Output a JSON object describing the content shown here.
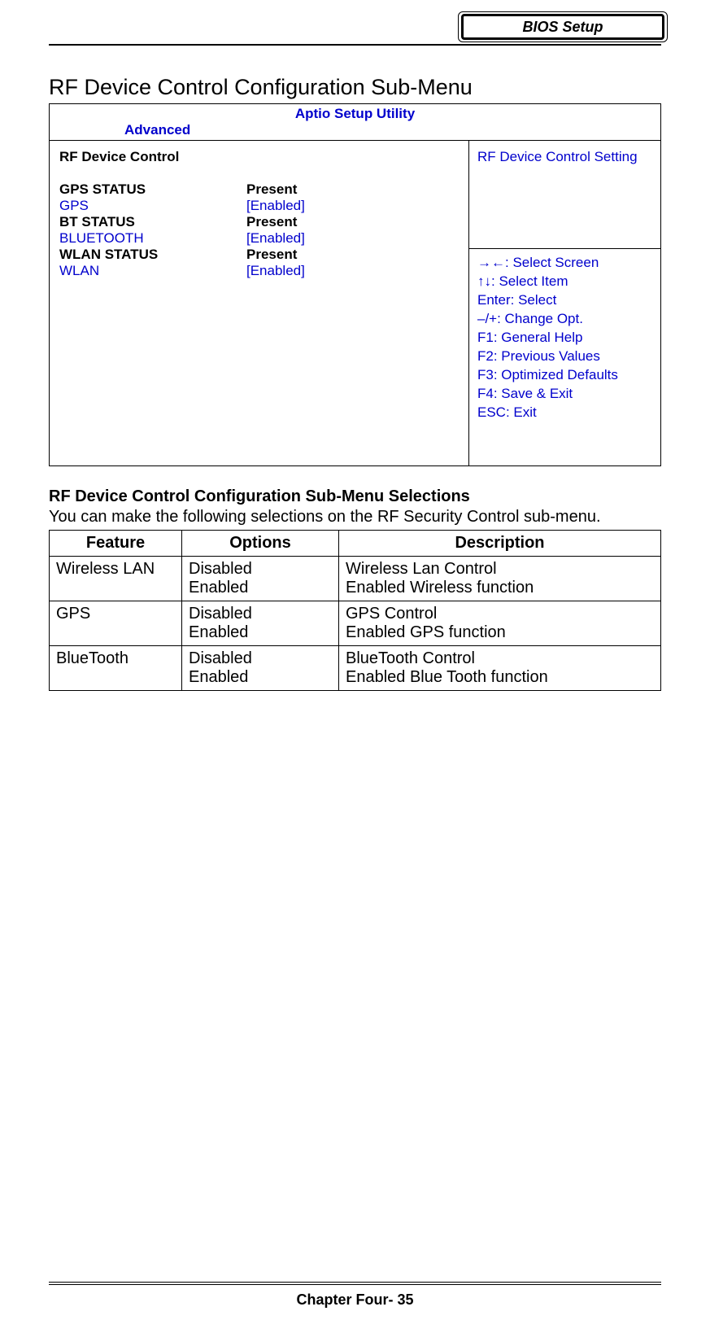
{
  "chapter_badge": "BIOS Setup",
  "section_title": "RF Device Control Configuration Sub-Menu",
  "bios": {
    "utility_title": "Aptio Setup Utility",
    "tab": "Advanced",
    "panel_heading": "RF Device Control",
    "rows": [
      {
        "label": "GPS STATUS",
        "value": "Present",
        "editable": false
      },
      {
        "label": "GPS",
        "value": "[Enabled]",
        "editable": true
      },
      {
        "label": "BT STATUS",
        "value": "Present",
        "editable": false
      },
      {
        "label": "BLUETOOTH",
        "value": "[Enabled]",
        "editable": true
      },
      {
        "label": "WLAN STATUS",
        "value": "Present",
        "editable": false
      },
      {
        "label": "WLAN",
        "value": "[Enabled]",
        "editable": true
      }
    ],
    "help_text": "RF Device Control Setting",
    "keys": [
      "→←: Select Screen",
      "↑↓: Select Item",
      "Enter: Select",
      "–/+: Change Opt.",
      "F1: General Help",
      "F2: Previous Values",
      "F3: Optimized Defaults",
      "F4: Save & Exit",
      "ESC: Exit"
    ]
  },
  "subsection_heading": "RF Device Control Configuration Sub-Menu Selections",
  "intro_text": "You can make the following selections on the RF Security Control sub-menu.",
  "table": {
    "headers": [
      "Feature",
      "Options",
      "Description"
    ],
    "rows": [
      {
        "feature": "Wireless LAN",
        "options": [
          "Disabled",
          "Enabled"
        ],
        "description": [
          "Wireless Lan Control",
          "Enabled Wireless function"
        ]
      },
      {
        "feature": "GPS",
        "options": [
          "Disabled",
          "Enabled"
        ],
        "description": [
          "GPS Control",
          "Enabled GPS function"
        ]
      },
      {
        "feature": "BlueTooth",
        "options": [
          "Disabled",
          "Enabled"
        ],
        "description": [
          "BlueTooth Control",
          "Enabled Blue Tooth function"
        ]
      }
    ]
  },
  "footer": "Chapter Four- 35"
}
